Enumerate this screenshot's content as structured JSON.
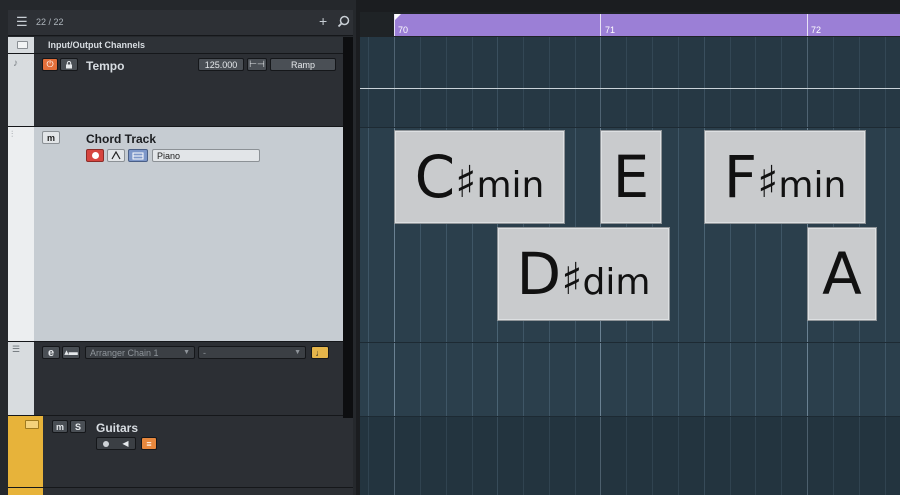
{
  "header": {
    "track_count": "22 / 22",
    "add_icon": "plus-icon",
    "search_icon": "search-icon"
  },
  "tracks": {
    "io": {
      "label": "Input/Output Channels"
    },
    "tempo": {
      "name": "Tempo",
      "bpm": "125.000",
      "mode": "Ramp"
    },
    "chord": {
      "name": "Chord Track",
      "mute": "m",
      "instrument": "Piano"
    },
    "arranger": {
      "chain": "Arranger Chain 1",
      "section": "-"
    },
    "guitars": {
      "name": "Guitars",
      "mute": "m",
      "solo": "S"
    }
  },
  "ruler": {
    "bars": [
      "70",
      "71",
      "72"
    ]
  },
  "chords": [
    "C♯min",
    "E",
    "F♯min",
    "D♯dim",
    "A"
  ],
  "colors": {
    "cycle": "#9b7fd6",
    "folder": "#e7b33a",
    "record": "#d6453f",
    "arranger_note": "#e5b54a"
  }
}
